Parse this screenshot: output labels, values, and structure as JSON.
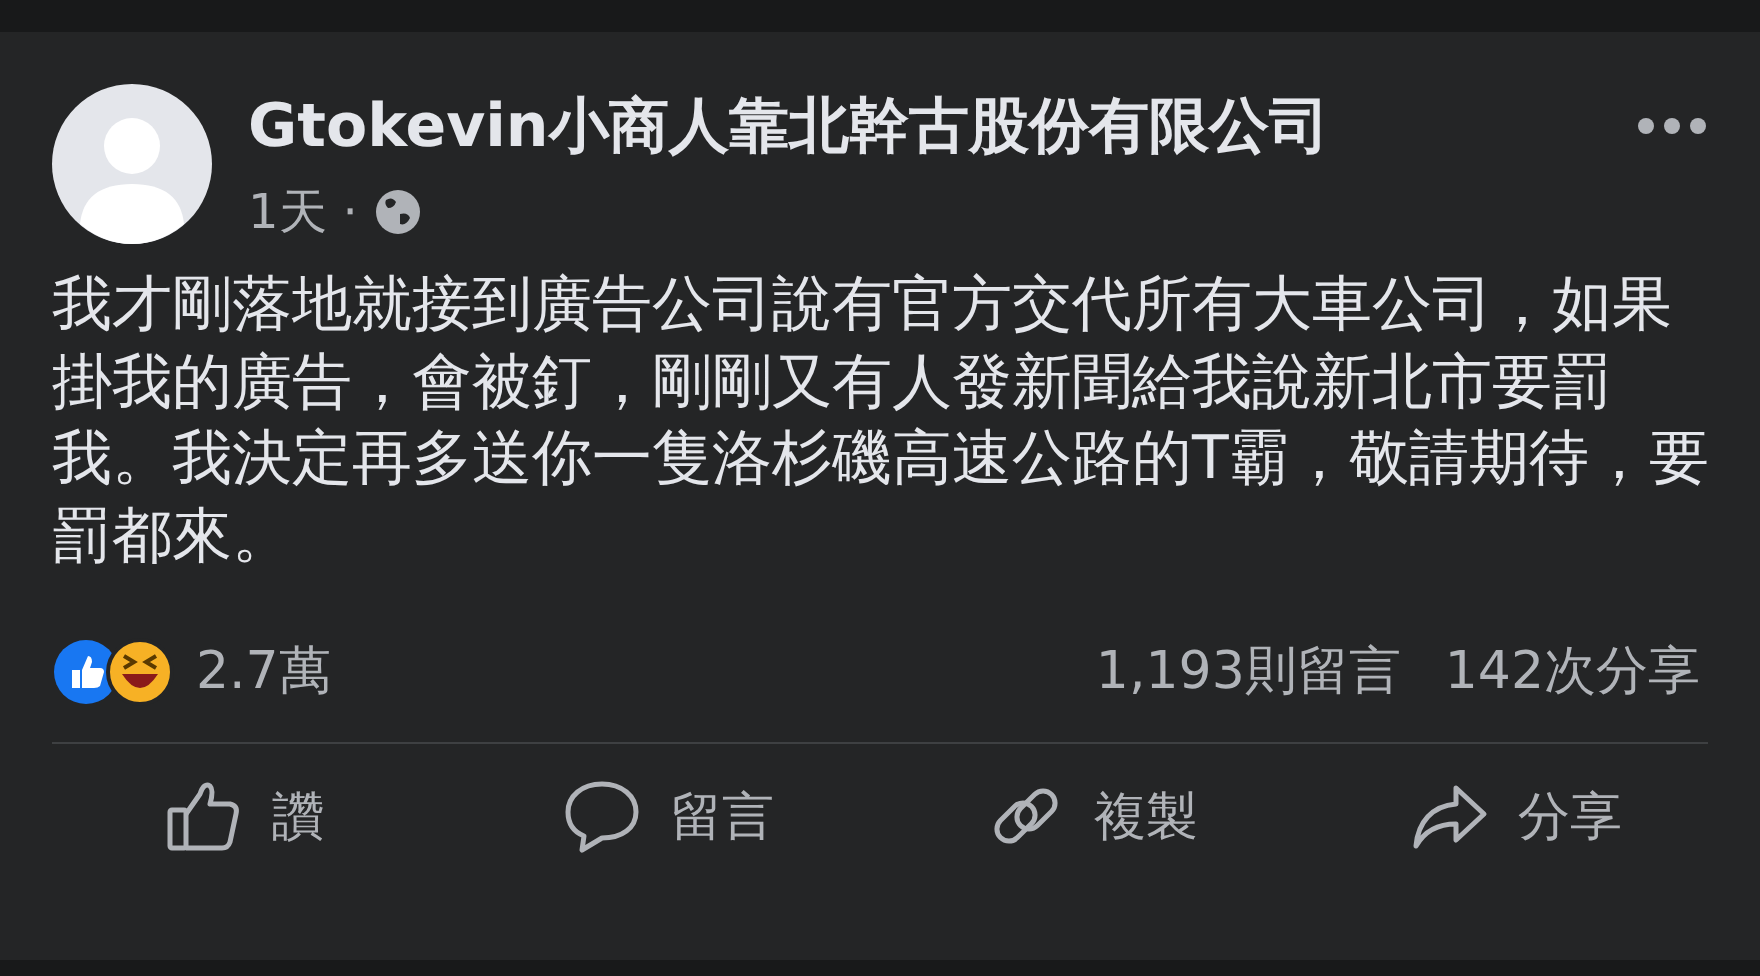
{
  "post": {
    "author": "Gtokevin小商人靠北幹古股份有限公司",
    "time": "1天",
    "separator": "·",
    "body": "我才剛落地就接到廣告公司說有官方交代所有大車公司，如果掛我的廣告，會被釘，剛剛又有人發新聞給我說新北市要罰我。我決定再多送你一隻洛杉磯高速公路的T霸，敬請期待，要罰都來。"
  },
  "stats": {
    "reactions": "2.7萬",
    "comments": "1,193則留言",
    "shares": "142次分享"
  },
  "actions": [
    {
      "kind": "like",
      "label": "讚"
    },
    {
      "kind": "comment",
      "label": "留言"
    },
    {
      "kind": "copy",
      "label": "複製"
    },
    {
      "kind": "share",
      "label": "分享"
    }
  ]
}
